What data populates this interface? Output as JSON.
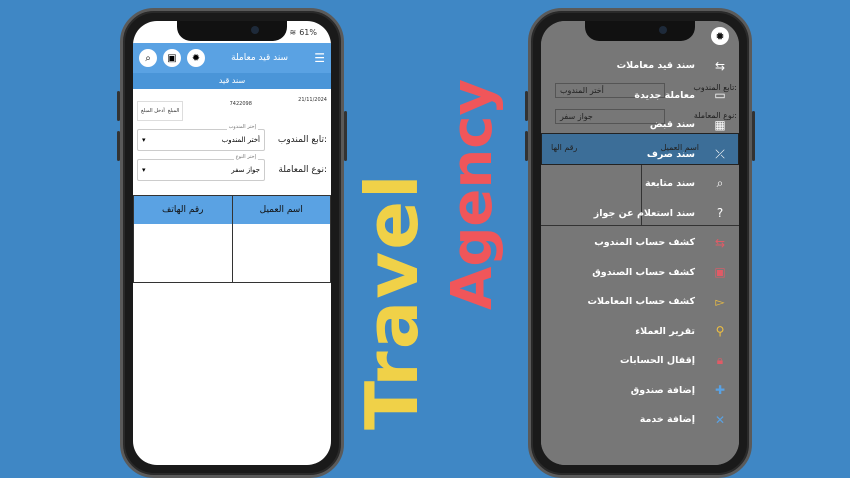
{
  "brand": {
    "travel": "Travel",
    "agency": "Agency"
  },
  "left_phone": {
    "status": {
      "battery": "61%"
    },
    "appbar": {
      "title": "سند قيد معاملة",
      "menu_icon": "menu-icon",
      "search_icon": "search-icon",
      "save_icon": "save-icon",
      "gear_icon": "gear-icon"
    },
    "subtitle": "سند قيد",
    "info": {
      "date": "21/11/2024",
      "number": "7422098",
      "amount_label": "المبلغ",
      "amount_value": "أدخل المبلغ"
    },
    "agent": {
      "label": "تابع المندوب:",
      "hint": "إختر المندوب",
      "value": "أختر المندوب"
    },
    "type": {
      "label": "نوع المعاملة:",
      "hint": "إختر النوع",
      "value": "جواز سفر"
    },
    "table": {
      "headers": [
        "اسم العميل",
        "رقم الهاتف"
      ]
    }
  },
  "right_phone": {
    "background": {
      "agent_label": "تابع المندوب:",
      "agent_value": "أختر المندوب",
      "type_label": "نوع المعاملة:",
      "type_value": "جواز سفر",
      "col_name": "اسم العميل",
      "col_phone": "رقم الها"
    },
    "menu": [
      {
        "label": "سند قيد معاملات",
        "icon": "link-icon",
        "color": "#ffffff"
      },
      {
        "label": "معاملة جديدة",
        "icon": "card-add-icon",
        "color": "#ffffff"
      },
      {
        "label": "سند قبض",
        "icon": "table-icon",
        "color": "#ffffff"
      },
      {
        "label": "سند صرف",
        "icon": "link-off-icon",
        "color": "#ffffff"
      },
      {
        "label": "سند متابعة",
        "icon": "search-icon",
        "color": "#ffffff"
      },
      {
        "label": "سند استعلام عن جواز",
        "icon": "question-icon",
        "color": "#ffffff"
      },
      {
        "label": "كشف حساب المندوب",
        "icon": "link-icon",
        "color": "#e05b66"
      },
      {
        "label": "كشف حساب الصندوق",
        "icon": "box-icon",
        "color": "#e05b66"
      },
      {
        "label": "كشف حساب المعاملات",
        "icon": "terminal-icon",
        "color": "#f0c040"
      },
      {
        "label": "تقرير العملاء",
        "icon": "user-search-icon",
        "color": "#f0c040"
      },
      {
        "label": "إقفال الحسابات",
        "icon": "lock-icon",
        "color": "#e05b66"
      },
      {
        "label": "إضافة صندوق",
        "icon": "user-add-icon",
        "color": "#5aa2e3"
      },
      {
        "label": "إضافة خدمة",
        "icon": "tools-icon",
        "color": "#5aa2e3"
      }
    ]
  }
}
